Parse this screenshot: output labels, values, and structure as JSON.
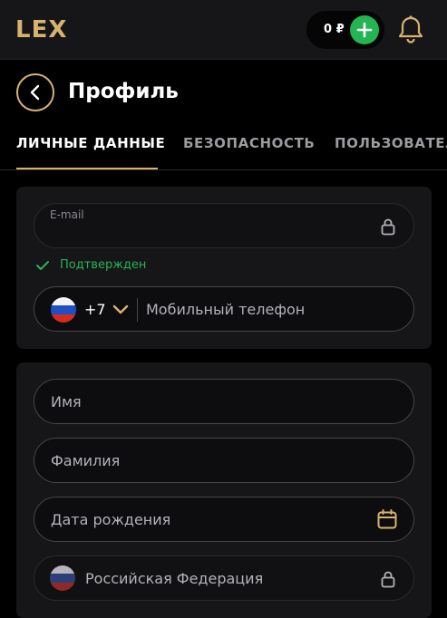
{
  "topbar": {
    "logo": "LEX",
    "balance": "0 ₽",
    "icons": {
      "add": "plus-icon",
      "bell": "bell-icon"
    }
  },
  "header": {
    "title": "Профиль",
    "back_icon": "chevron-left-icon"
  },
  "tabs": [
    {
      "label": "ЛИЧНЫЕ ДАННЫЕ",
      "active": true
    },
    {
      "label": "БЕЗОПАСНОСТЬ",
      "active": false
    },
    {
      "label": "ПОЛЬЗОВАТЕЛЬ",
      "active": false
    }
  ],
  "contacts": {
    "email": {
      "label": "E-mail",
      "value": "",
      "locked": true
    },
    "verified": "Подтвержден",
    "phone": {
      "code": "+7",
      "placeholder": "Мобильный телефон",
      "flag": "ru-flag"
    }
  },
  "personal": {
    "first_name": {
      "placeholder": "Имя"
    },
    "last_name": {
      "placeholder": "Фамилия"
    },
    "birth_date": {
      "placeholder": "Дата рождения"
    },
    "country": {
      "value": "Российская Федерация",
      "locked": true,
      "flag": "ru-flag"
    }
  },
  "colors": {
    "accent": "#d9b270",
    "success": "#25b454",
    "background": "#000000",
    "card": "#161618"
  }
}
